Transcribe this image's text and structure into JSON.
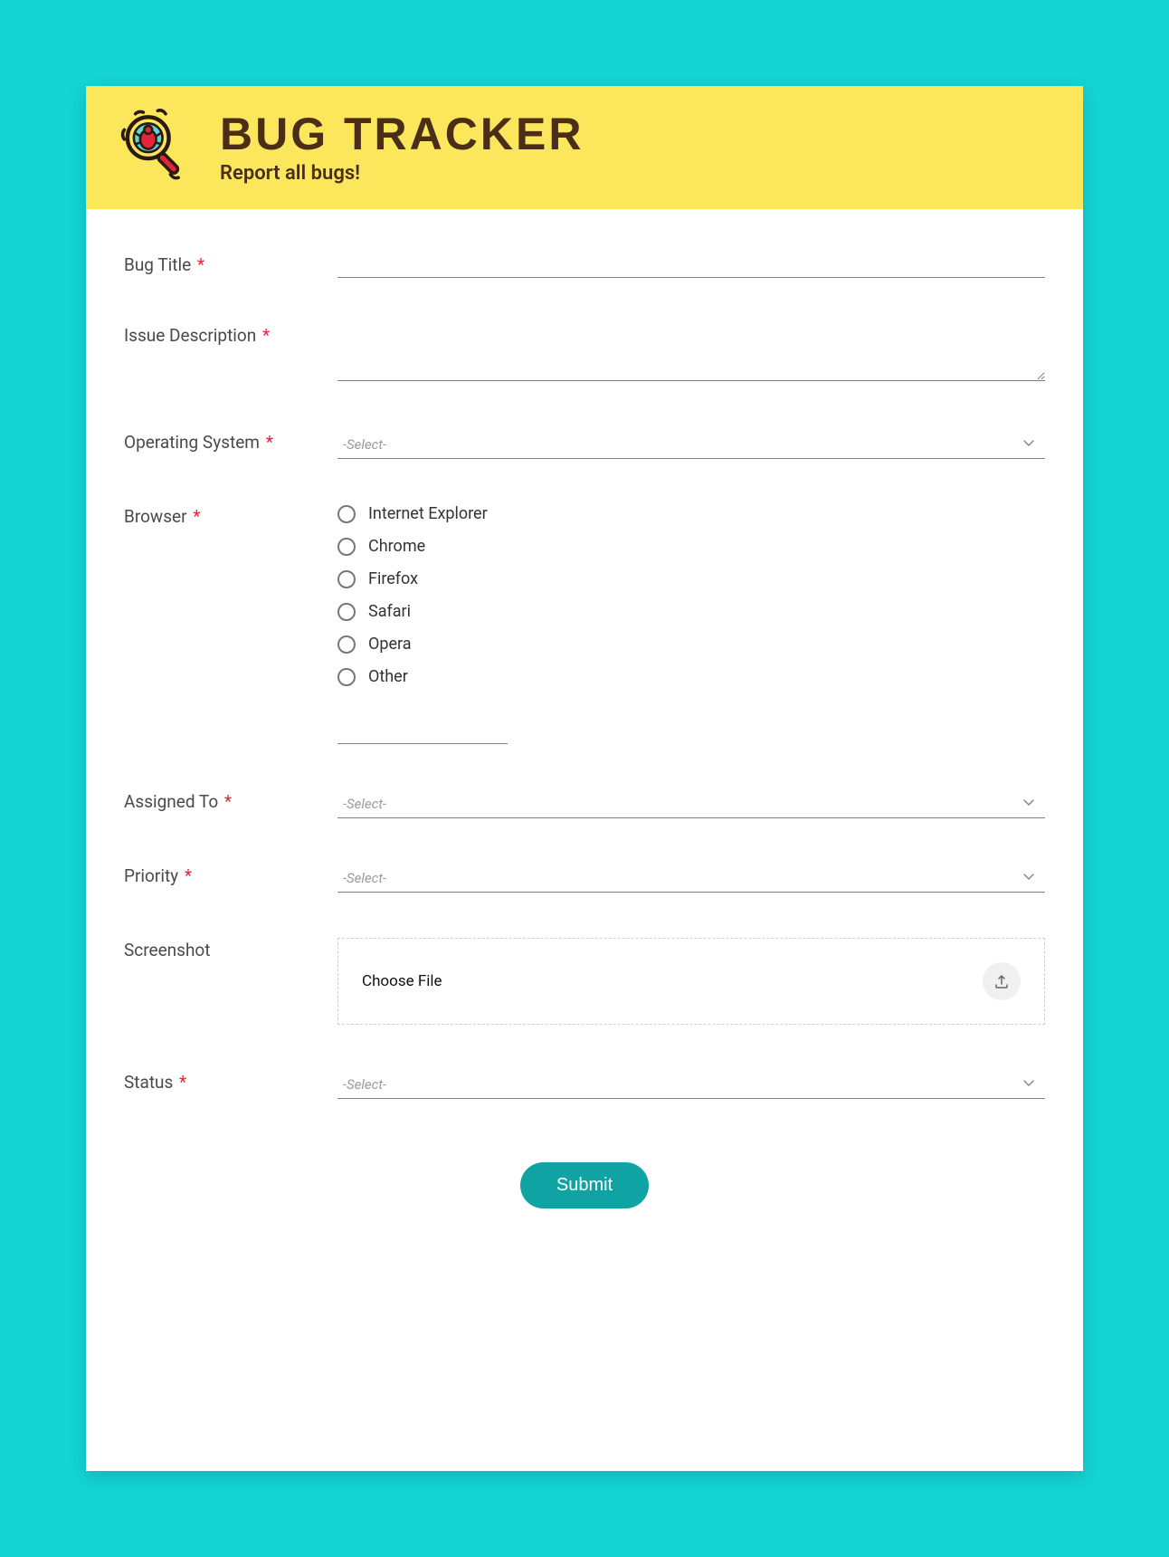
{
  "header": {
    "title": "BUG TRACKER",
    "subtitle": "Report all bugs!"
  },
  "labels": {
    "bug_title": "Bug Title",
    "issue_description": "Issue Description",
    "operating_system": "Operating System",
    "browser": "Browser",
    "assigned_to": "Assigned To",
    "priority": "Priority",
    "screenshot": "Screenshot",
    "status": "Status",
    "required_mark": "*"
  },
  "select_placeholder": "-Select-",
  "browser_options": [
    "Internet Explorer",
    "Chrome",
    "Firefox",
    "Safari",
    "Opera",
    "Other"
  ],
  "file": {
    "choose_label": "Choose File"
  },
  "submit_label": "Submit"
}
